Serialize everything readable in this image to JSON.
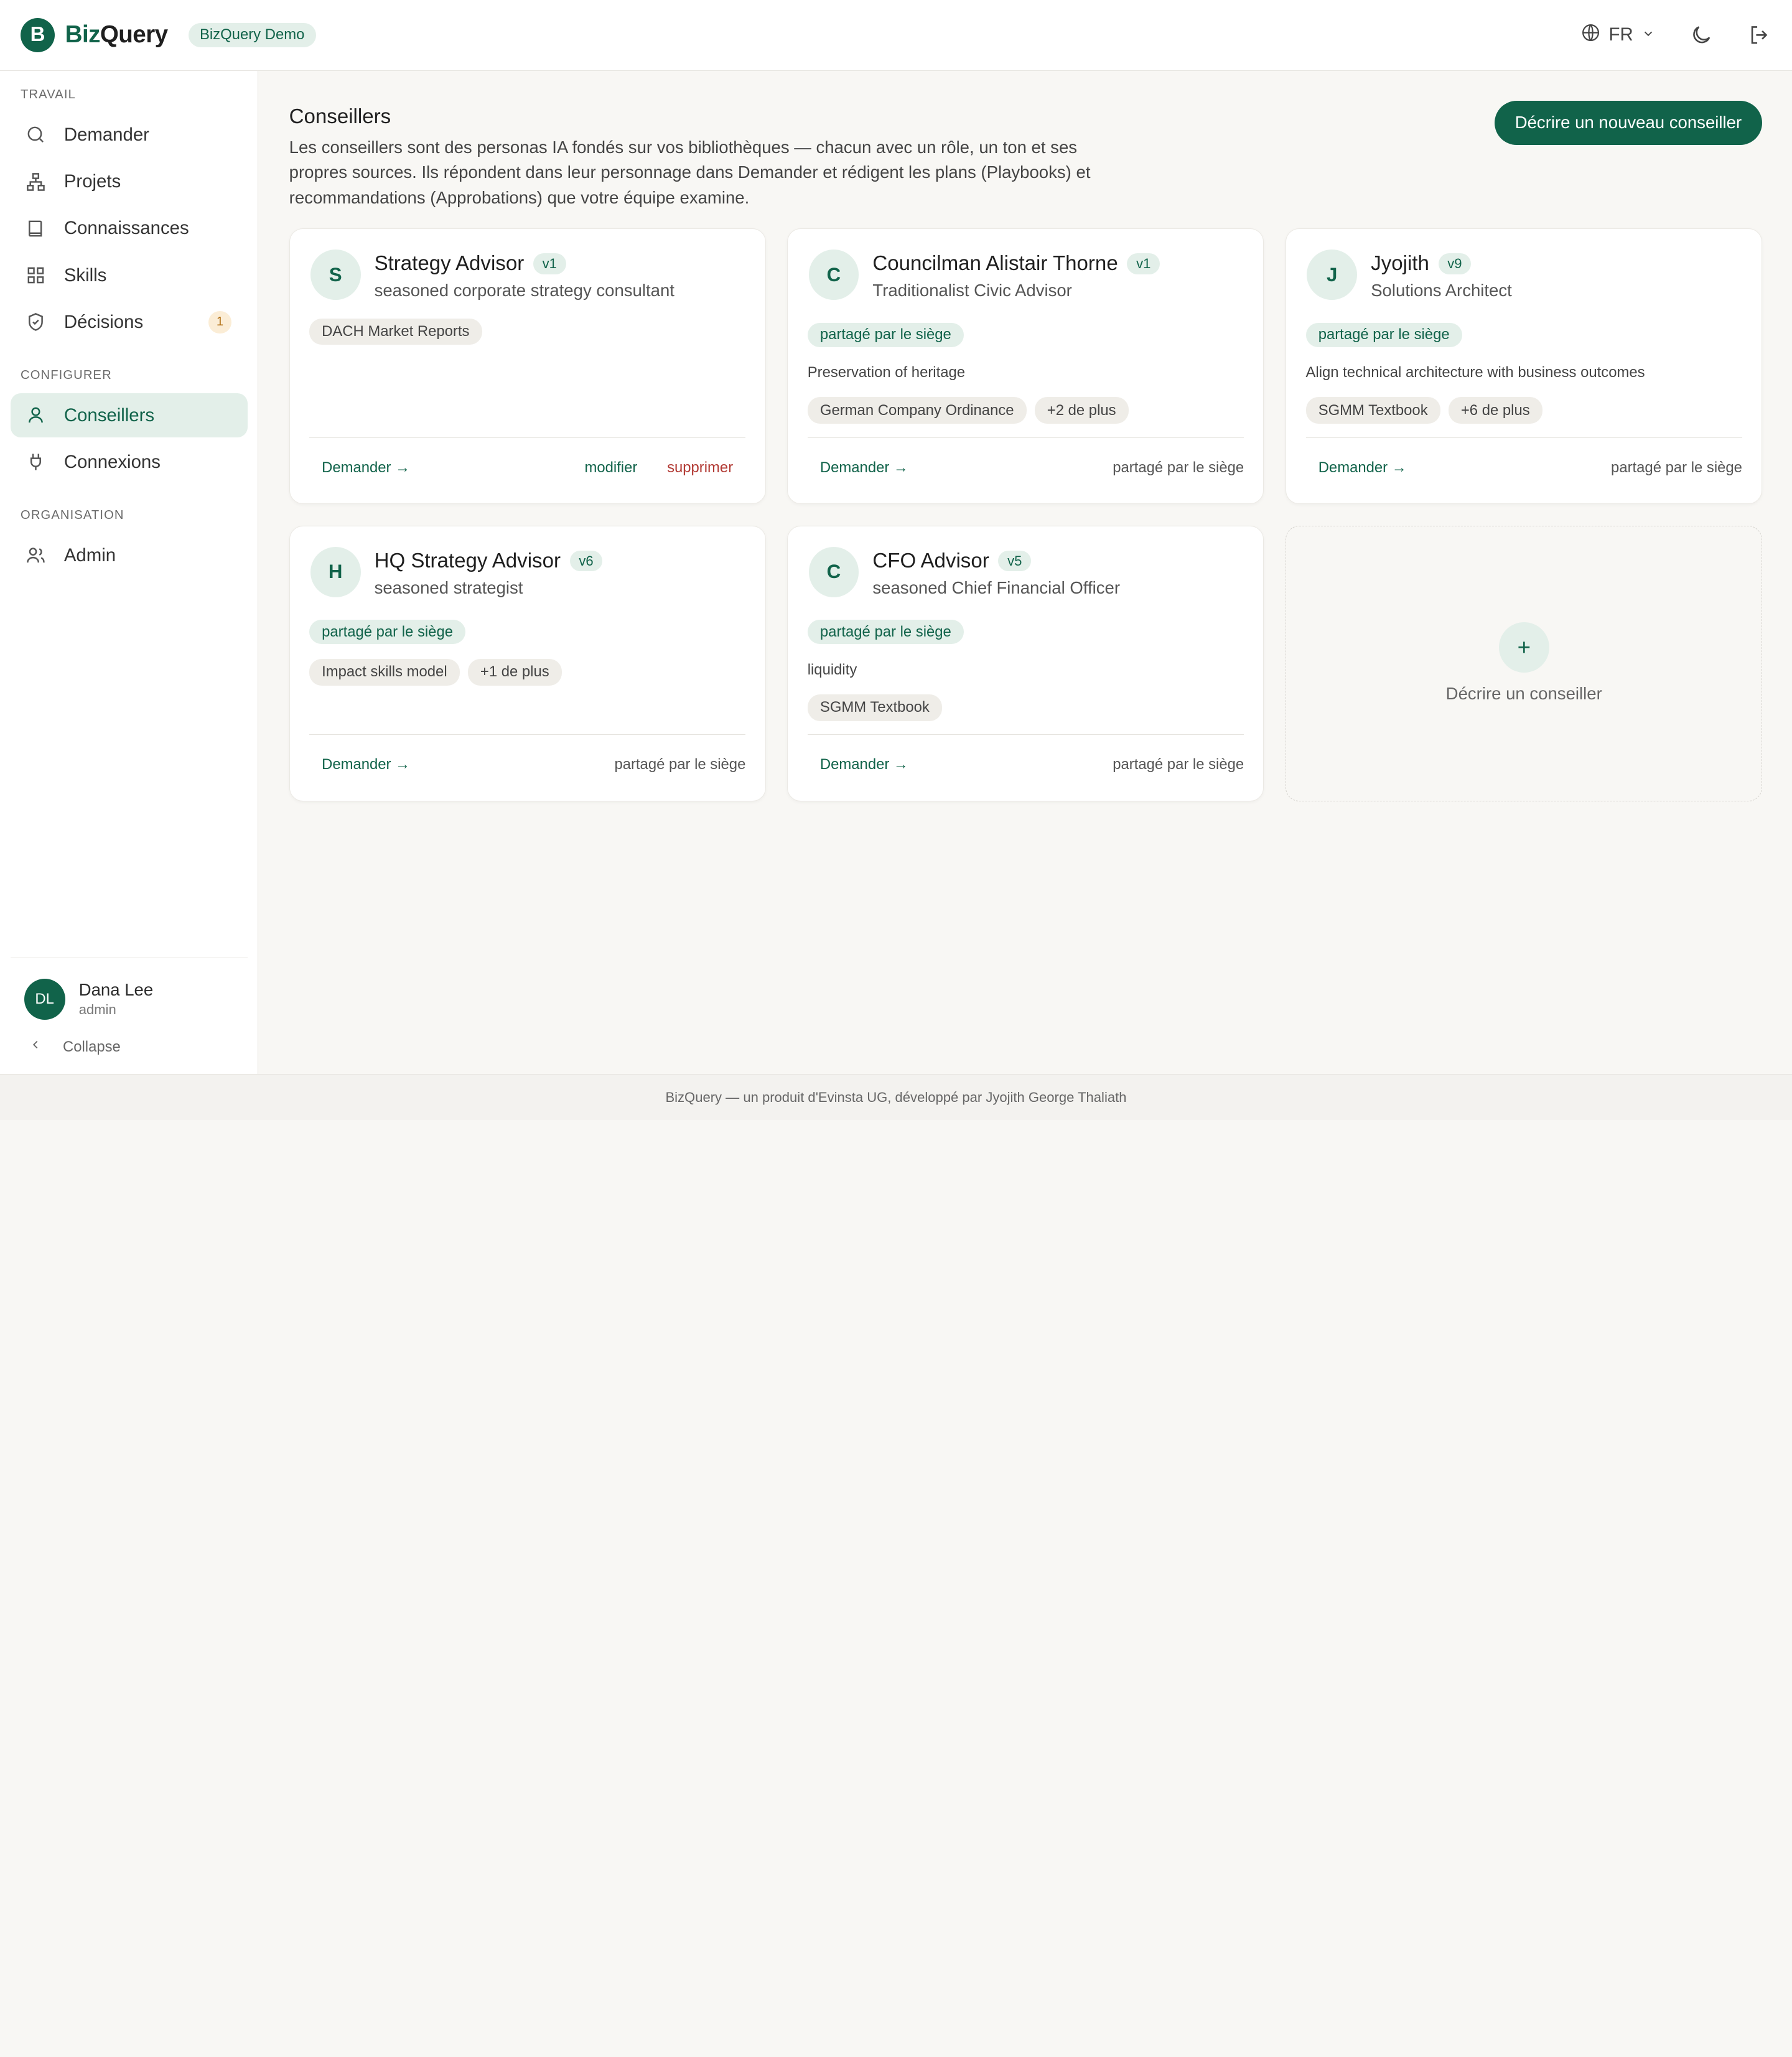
{
  "header": {
    "logo_letter": "B",
    "brand_main": "Biz",
    "brand_q": "Query",
    "demo_badge": "BizQuery Demo",
    "lang": "FR"
  },
  "sidebar": {
    "sections": {
      "travail": "TRAVAIL",
      "configurer": "CONFIGURER",
      "organisation": "ORGANISATION"
    },
    "items": [
      {
        "label": "Demander",
        "icon": "search-icon"
      },
      {
        "label": "Projets",
        "icon": "org-icon"
      },
      {
        "label": "Connaissances",
        "icon": "book-icon"
      },
      {
        "label": "Skills",
        "icon": "grid-icon"
      },
      {
        "label": "Décisions",
        "icon": "shield-icon",
        "badge": "1"
      },
      {
        "label": "Conseillers",
        "icon": "user-icon",
        "active": true
      },
      {
        "label": "Connexions",
        "icon": "plug-icon"
      },
      {
        "label": "Admin",
        "icon": "users-icon"
      }
    ],
    "user": {
      "initials": "DL",
      "name": "Dana Lee",
      "role": "admin"
    },
    "collapse": "Collapse"
  },
  "main": {
    "title": "Conseillers",
    "description": "Les conseillers sont des personas IA fondés sur vos bibliothèques — chacun avec un rôle, un ton et ses propres sources. Ils répondent dans leur personnage dans Demander et rédigent les plans (Playbooks) et recommandations (Approbations) que votre équipe examine.",
    "new_button": "Décrire un nouveau conseiller",
    "cards": [
      {
        "initial": "S",
        "name": "Strategy Advisor",
        "version": "v1",
        "role": "seasoned corporate strategy consultant",
        "chips": [
          "DACH Market Reports"
        ],
        "ask": "Demander →",
        "edit": "modifier",
        "delete": "supprimer"
      },
      {
        "initial": "C",
        "name": "Councilman Alistair Thorne",
        "version": "v1",
        "role": "Traditionalist Civic Advisor",
        "shared": "partagé par le siège",
        "focus": "Preservation of heritage",
        "chips": [
          "German Company Ordinance",
          "+2 de plus"
        ],
        "ask": "Demander →",
        "shared_text": "partagé par le siège"
      },
      {
        "initial": "J",
        "name": "Jyojith",
        "version": "v9",
        "role": "Solutions Architect",
        "shared": "partagé par le siège",
        "focus": "Align technical architecture with business outcomes",
        "chips": [
          "SGMM Textbook",
          "+6 de plus"
        ],
        "ask": "Demander →",
        "shared_text": "partagé par le siège"
      },
      {
        "initial": "H",
        "name": "HQ Strategy Advisor",
        "version": "v6",
        "role": "seasoned strategist",
        "shared": "partagé par le siège",
        "chips": [
          "Impact skills model",
          "+1 de plus"
        ],
        "ask": "Demander →",
        "shared_text": "partagé par le siège"
      },
      {
        "initial": "C",
        "name": "CFO Advisor",
        "version": "v5",
        "role": "seasoned Chief Financial Officer",
        "shared": "partagé par le siège",
        "focus": "liquidity",
        "chips": [
          "SGMM Textbook"
        ],
        "ask": "Demander →",
        "shared_text": "partagé par le siège"
      }
    ],
    "add_card": {
      "plus": "+",
      "label": "Décrire un conseiller"
    }
  },
  "footer": "BizQuery — un produit d'Evinsta UG, développé par Jyojith George Thaliath",
  "colors": {
    "accent": "#11634a",
    "accent_light": "#e3efe9",
    "danger": "#b23a34",
    "badge_orange": "#b06d10"
  }
}
